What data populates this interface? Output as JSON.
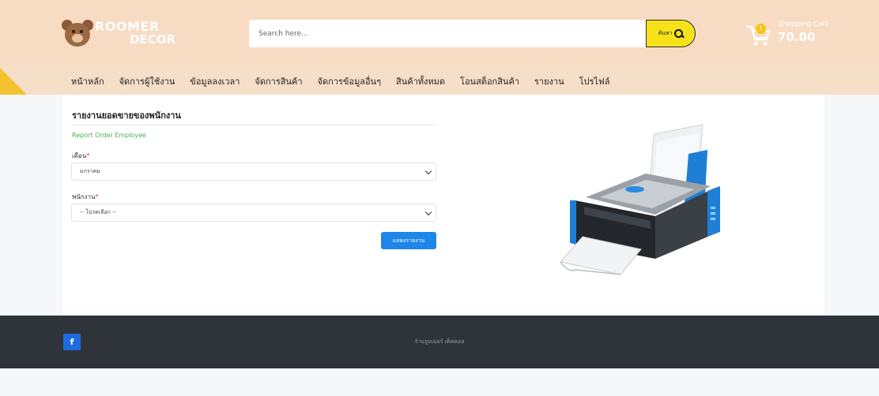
{
  "header": {
    "logo_line1": "ROOMER",
    "logo_line2": "DECOR",
    "search_placeholder": "Search here...",
    "search_button_label": "ค้นหา",
    "cart_label": "Shopping Cart",
    "cart_total": "70.00",
    "cart_badge": "1",
    "accent_color": "#f7e21a",
    "bg_color": "#f7dcc3"
  },
  "nav": {
    "items": [
      {
        "label": "หน้าหลัก"
      },
      {
        "label": "จัดการผู้ใช้งาน"
      },
      {
        "label": "ข้อมูลลงเวลา"
      },
      {
        "label": "จัดการสินค้า"
      },
      {
        "label": "จัดการข้อมูลอื่นๆ"
      },
      {
        "label": "สินค้าทั้งหมด"
      },
      {
        "label": "โอนสต็อกสินค้า"
      },
      {
        "label": "รายงาน"
      },
      {
        "label": "โปรไฟล์"
      }
    ]
  },
  "form": {
    "title": "รายงานยอดขายของพนักงาน",
    "subtitle": "Report Order Employee",
    "month_label": "เดือน",
    "month_value": "มกราคม",
    "employee_label": "พนักงาน",
    "employee_value": "-- โปรดเลือก --",
    "required_mark": "*",
    "submit_label": "แสดงรายงาน",
    "button_color": "#1d86e8"
  },
  "illustration": {
    "icon": "printer-icon"
  },
  "footer": {
    "facebook_label": "f",
    "copyright": "ร้านรูมเมอร์ เด็คคอล"
  }
}
